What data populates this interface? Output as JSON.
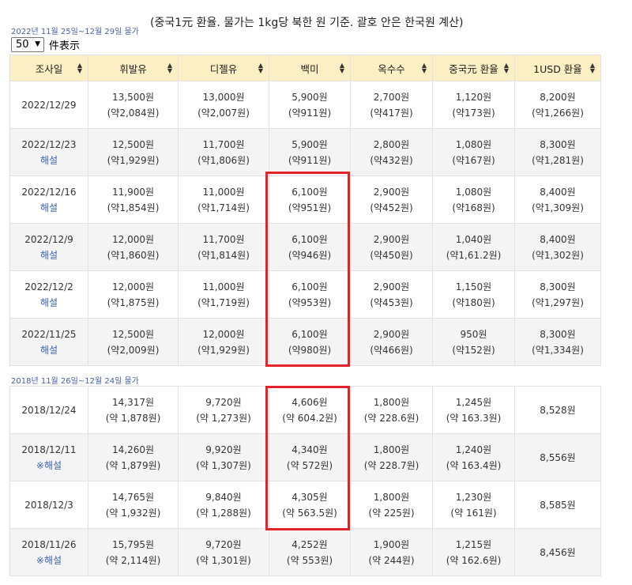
{
  "header": {
    "caption_2022": "2022년 11월 25일~12월 29일 물가",
    "note": "(중국1元 환율.  물가는 1kg당 북한 원 기준. 괄호 안은 한국원 계산)",
    "length_value": "50",
    "length_label": "件表示"
  },
  "columns": [
    "조사일",
    "휘발유",
    "디젤유",
    "백미",
    "옥수수",
    "중국元 환율",
    "1USD 환율"
  ],
  "table_2022": [
    {
      "date": "2022/12/29",
      "note": "",
      "cells": [
        [
          "13,500원",
          "(약2,084원)"
        ],
        [
          "13,000원",
          "(약2,007원)"
        ],
        [
          "5,900원",
          "(약911원)"
        ],
        [
          "2,700원",
          "(약417원)"
        ],
        [
          "1,120원",
          "(약173원)"
        ],
        [
          "8,200원",
          "(약1,266원)"
        ]
      ]
    },
    {
      "date": "2022/12/23",
      "note": "해설",
      "cells": [
        [
          "12,500원",
          "(약1,929원)"
        ],
        [
          "11,700원",
          "(약1,806원)"
        ],
        [
          "5,900원",
          "(약911원)"
        ],
        [
          "2,800원",
          "(약432원)"
        ],
        [
          "1,080원",
          "(약167원)"
        ],
        [
          "8,300원",
          "(약1,281원)"
        ]
      ]
    },
    {
      "date": "2022/12/16",
      "note": "해설",
      "cells": [
        [
          "11,900원",
          "(약1,854원)"
        ],
        [
          "11,000원",
          "(약1,714원)"
        ],
        [
          "6,100원",
          "(약951원)"
        ],
        [
          "2,900원",
          "(약452원)"
        ],
        [
          "1,080원",
          "(약168원)"
        ],
        [
          "8,400원",
          "(약1,309원)"
        ]
      ]
    },
    {
      "date": "2022/12/9",
      "note": "해설",
      "cells": [
        [
          "12,000원",
          "(약1,860원)"
        ],
        [
          "11,700원",
          "(약1,814원)"
        ],
        [
          "6,100원",
          "(약946원)"
        ],
        [
          "2,900원",
          "(약450원)"
        ],
        [
          "1,040원",
          "(약1,61.2원)"
        ],
        [
          "8,400원",
          "(약1,302원)"
        ]
      ]
    },
    {
      "date": "2022/12/2",
      "note": "해설",
      "cells": [
        [
          "12,000원",
          "(약1,875원)"
        ],
        [
          "11,000원",
          "(약1,719원)"
        ],
        [
          "6,100원",
          "(약953원)"
        ],
        [
          "2,900원",
          "(약453원)"
        ],
        [
          "1,150원",
          "(약180원)"
        ],
        [
          "8,300원",
          "(약1,297원)"
        ]
      ]
    },
    {
      "date": "2022/11/25",
      "note": "해설",
      "cells": [
        [
          "12,500원",
          "(약2,009원)"
        ],
        [
          "12,000원",
          "(약1,929원)"
        ],
        [
          "6,100원",
          "(약980원)"
        ],
        [
          "2,900원",
          "(약466원)"
        ],
        [
          "950원",
          "(약152원)"
        ],
        [
          "8,300원",
          "(약1,334원)"
        ]
      ]
    }
  ],
  "caption_2018": "2018년 11월 26일~12월 24일 물가",
  "table_2018": [
    {
      "date": "2018/12/24",
      "note": "",
      "cells": [
        [
          "14,317원",
          "(약 1,878원)"
        ],
        [
          "9,720원",
          "(약 1,273원)"
        ],
        [
          "4,606원",
          "(약 604.2원)"
        ],
        [
          "1,800원",
          "(약 228.6원)"
        ],
        [
          "1,245원",
          "(약 163.3원)"
        ],
        [
          "8,528원",
          ""
        ]
      ]
    },
    {
      "date": "2018/12/11",
      "note": "※해설",
      "cells": [
        [
          "14,260원",
          "(약 1,879원)"
        ],
        [
          "9,920원",
          "(약 1,307원)"
        ],
        [
          "4,340원",
          "(약 572원)"
        ],
        [
          "1,800원",
          "(약 228.7원)"
        ],
        [
          "1,240원",
          "(약 163.4원)"
        ],
        [
          "8,556원",
          ""
        ]
      ]
    },
    {
      "date": "2018/12/3",
      "note": "",
      "cells": [
        [
          "14,765원",
          "(약 1,932원)"
        ],
        [
          "9,840원",
          "(약 1,288원)"
        ],
        [
          "4,305원",
          "(약 563.5원)"
        ],
        [
          "1,800원",
          "(약 225원)"
        ],
        [
          "1,230원",
          "(약 161원)"
        ],
        [
          "8,585원",
          ""
        ]
      ]
    },
    {
      "date": "2018/11/26",
      "note": "※해설",
      "cells": [
        [
          "15,795원",
          "(약 2,114원)"
        ],
        [
          "9,720원",
          "(약 1,301원)"
        ],
        [
          "4,252원",
          "(약 553원)"
        ],
        [
          "1,900원",
          "(약 244원)"
        ],
        [
          "1,215원",
          "(약 162.6원)"
        ],
        [
          "8,456원",
          ""
        ]
      ]
    }
  ],
  "colors": {
    "header_bg": "#fcefc4",
    "highlight_border": "#e3232a",
    "link": "#3a62b8",
    "caption": "#4a5fa8"
  }
}
